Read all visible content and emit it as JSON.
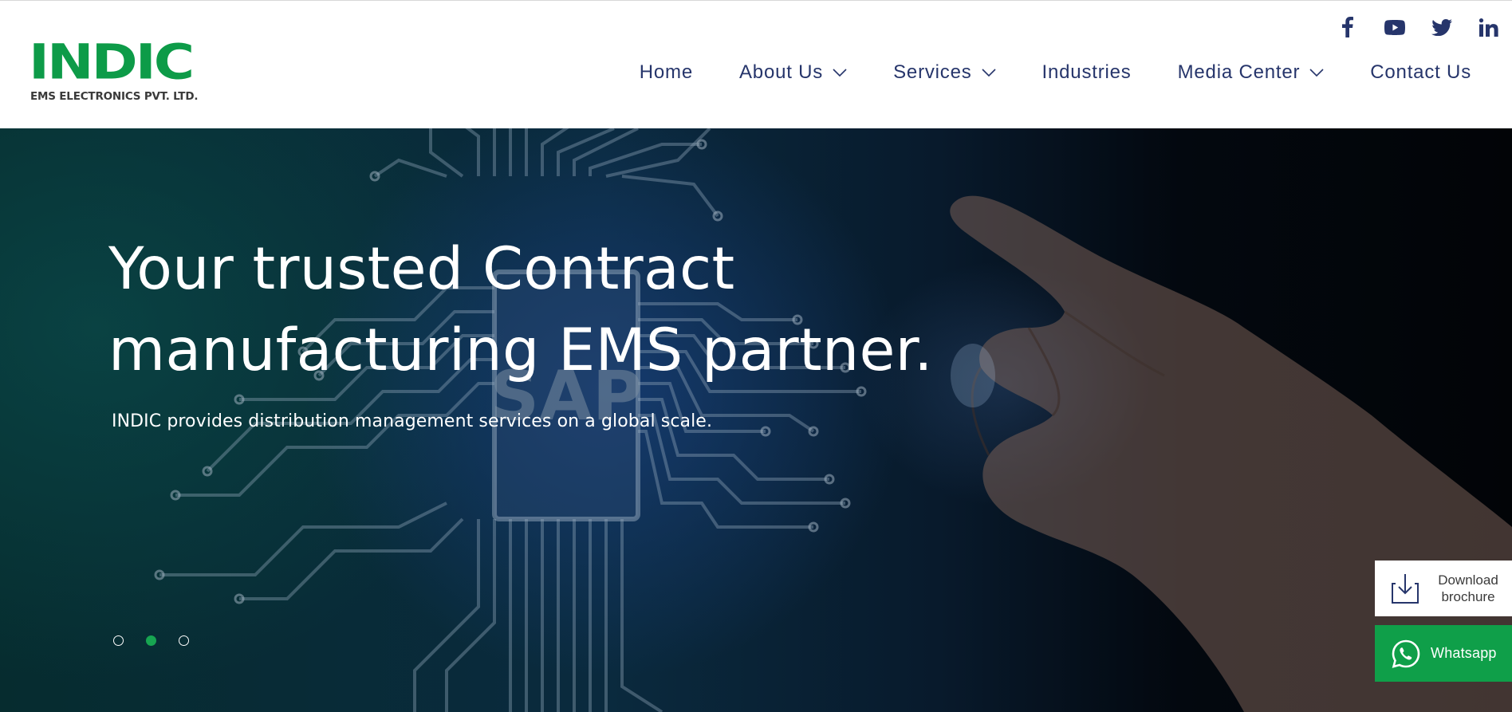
{
  "logo": {
    "wordmark": "INDIC",
    "tagline": "EMS ELECTRONICS PVT. LTD."
  },
  "social": [
    {
      "icon": "facebook-icon"
    },
    {
      "icon": "youtube-icon"
    },
    {
      "icon": "twitter-icon"
    },
    {
      "icon": "linkedin-icon"
    }
  ],
  "nav": {
    "items": [
      {
        "label": "Home",
        "has_dropdown": false
      },
      {
        "label": "About Us",
        "has_dropdown": true
      },
      {
        "label": "Services",
        "has_dropdown": true
      },
      {
        "label": "Industries",
        "has_dropdown": false
      },
      {
        "label": "Media Center",
        "has_dropdown": true
      },
      {
        "label": "Contact Us",
        "has_dropdown": false
      }
    ]
  },
  "hero": {
    "title_line1": "Your trusted Contract",
    "title_line2": "manufacturing EMS partner.",
    "subtitle": "INDIC provides distribution management services on a global scale.",
    "chip_label": "SAP",
    "slides": {
      "count": 3,
      "active_index": 1
    }
  },
  "widgets": {
    "brochure_line1": "Download",
    "brochure_line2": "brochure",
    "whatsapp_label": "Whatsapp"
  },
  "colors": {
    "brand_green": "#0d9b48",
    "nav_text": "#26356b",
    "whatsapp_green": "#0f9f49"
  }
}
